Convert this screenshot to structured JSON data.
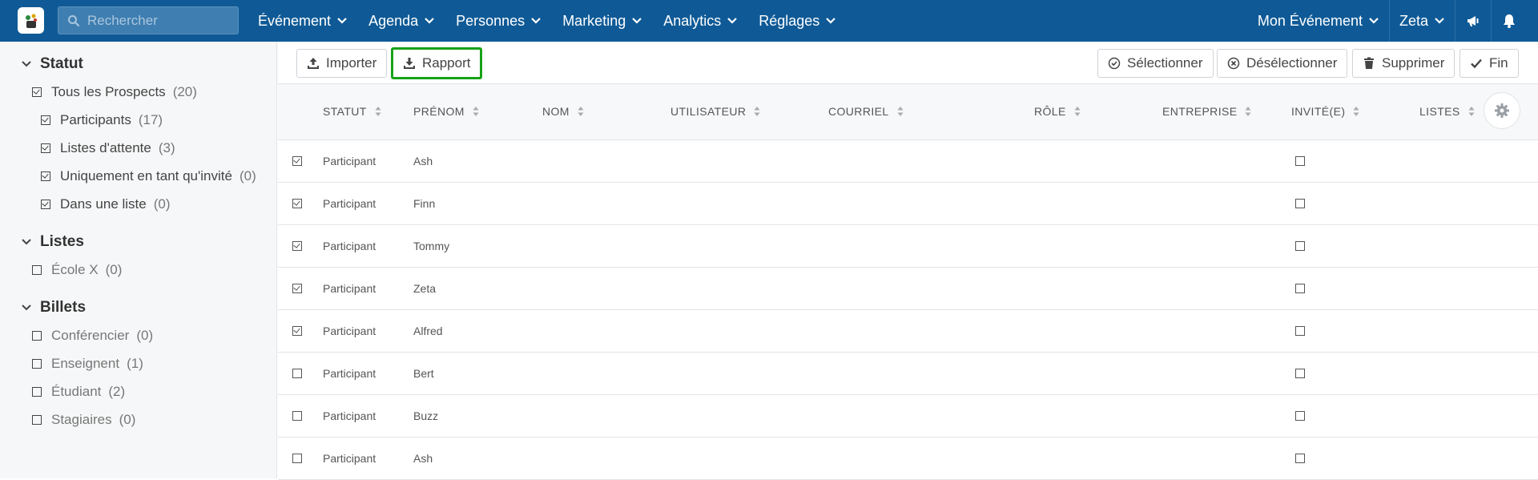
{
  "topbar": {
    "search_placeholder": "Rechercher",
    "nav": [
      {
        "label": "Événement"
      },
      {
        "label": "Agenda"
      },
      {
        "label": "Personnes"
      },
      {
        "label": "Marketing"
      },
      {
        "label": "Analytics"
      },
      {
        "label": "Réglages"
      }
    ],
    "event_menu": "Mon Événement",
    "user_menu": "Zeta",
    "colors": {
      "bar": "#0f5a96",
      "highlight": "#17a217"
    }
  },
  "sidebar": {
    "statut": {
      "title": "Statut",
      "items": [
        {
          "label": "Tous les Prospects",
          "count": "(20)",
          "checked": true
        },
        {
          "label": "Participants",
          "count": "(17)",
          "checked": true
        },
        {
          "label": "Listes d'attente",
          "count": "(3)",
          "checked": true
        },
        {
          "label": "Uniquement en tant qu'invité",
          "count": "(0)",
          "checked": true
        },
        {
          "label": "Dans une liste",
          "count": "(0)",
          "checked": true
        }
      ]
    },
    "listes": {
      "title": "Listes",
      "items": [
        {
          "label": "École X",
          "count": "(0)",
          "checked": false
        }
      ]
    },
    "billets": {
      "title": "Billets",
      "items": [
        {
          "label": "Conférencier",
          "count": "(0)",
          "checked": false
        },
        {
          "label": "Enseignent",
          "count": "(1)",
          "checked": false
        },
        {
          "label": "Étudiant",
          "count": "(2)",
          "checked": false
        },
        {
          "label": "Stagiaires",
          "count": "(0)",
          "checked": false
        }
      ]
    }
  },
  "toolbar": {
    "import_label": "Importer",
    "report_label": "Rapport",
    "select_label": "Sélectionner",
    "deselect_label": "Désélectionner",
    "delete_label": "Supprimer",
    "finish_label": "Fin"
  },
  "table": {
    "columns": [
      "STATUT",
      "PRÉNOM",
      "NOM",
      "UTILISATEUR",
      "COURRIEL",
      "RÔLE",
      "ENTREPRISE",
      "INVITÉ(E)",
      "LISTES"
    ],
    "rows": [
      {
        "selected": true,
        "statut": "Participant",
        "prenom": "Ash"
      },
      {
        "selected": true,
        "statut": "Participant",
        "prenom": "Finn"
      },
      {
        "selected": true,
        "statut": "Participant",
        "prenom": "Tommy"
      },
      {
        "selected": true,
        "statut": "Participant",
        "prenom": "Zeta"
      },
      {
        "selected": true,
        "statut": "Participant",
        "prenom": "Alfred"
      },
      {
        "selected": false,
        "statut": "Participant",
        "prenom": "Bert"
      },
      {
        "selected": false,
        "statut": "Participant",
        "prenom": "Buzz"
      },
      {
        "selected": false,
        "statut": "Participant",
        "prenom": "Ash"
      }
    ]
  }
}
